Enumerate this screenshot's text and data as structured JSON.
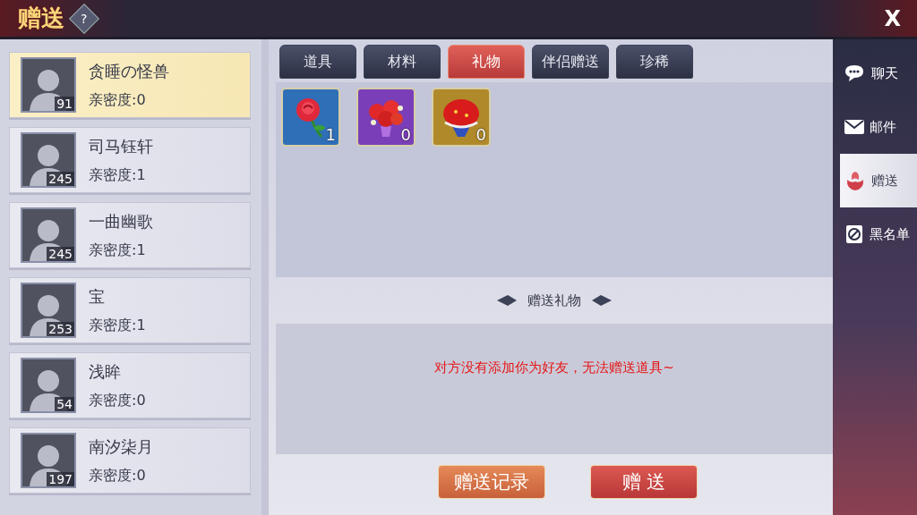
{
  "header": {
    "title": "赠送",
    "help": "?",
    "close": "X"
  },
  "friends": [
    {
      "name": "贪睡の怪兽",
      "intimacy": "亲密度:0",
      "level": "91",
      "selected": true
    },
    {
      "name": "司马钰轩",
      "intimacy": "亲密度:1",
      "level": "245",
      "selected": false
    },
    {
      "name": "一曲幽歌",
      "intimacy": "亲密度:1",
      "level": "245",
      "selected": false
    },
    {
      "name": "宝",
      "intimacy": "亲密度:1",
      "level": "253",
      "selected": false
    },
    {
      "name": "浅眸",
      "intimacy": "亲密度:0",
      "level": "54",
      "selected": false
    },
    {
      "name": "南汐柒月",
      "intimacy": "亲密度:0",
      "level": "197",
      "selected": false
    }
  ],
  "tabs": [
    {
      "label": "道具",
      "selected": false
    },
    {
      "label": "材料",
      "selected": false
    },
    {
      "label": "礼物",
      "selected": true
    },
    {
      "label": "伴侣赠送",
      "selected": false
    },
    {
      "label": "珍稀",
      "selected": false
    }
  ],
  "items": [
    {
      "kind": "rose",
      "count": "1",
      "color": "#2f6fb8"
    },
    {
      "kind": "bouquet",
      "count": "0",
      "color": "#7a3fb8"
    },
    {
      "kind": "bigbouquet",
      "count": "0",
      "color": "#b08a2a"
    }
  ],
  "section_title": "赠送礼物",
  "message": "对方没有添加你为好友，无法赠送道具~",
  "buttons": [
    {
      "kind": "secondary",
      "label": "赠送记录"
    },
    {
      "kind": "primary",
      "label": "赠 送"
    }
  ],
  "side_nav": [
    {
      "kind": "chat",
      "label": "聊天",
      "selected": false
    },
    {
      "kind": "mail",
      "label": "邮件",
      "selected": false
    },
    {
      "kind": "gift",
      "label": "赠送",
      "selected": true
    },
    {
      "kind": "blacklist",
      "label": "黑名单",
      "selected": false
    }
  ]
}
